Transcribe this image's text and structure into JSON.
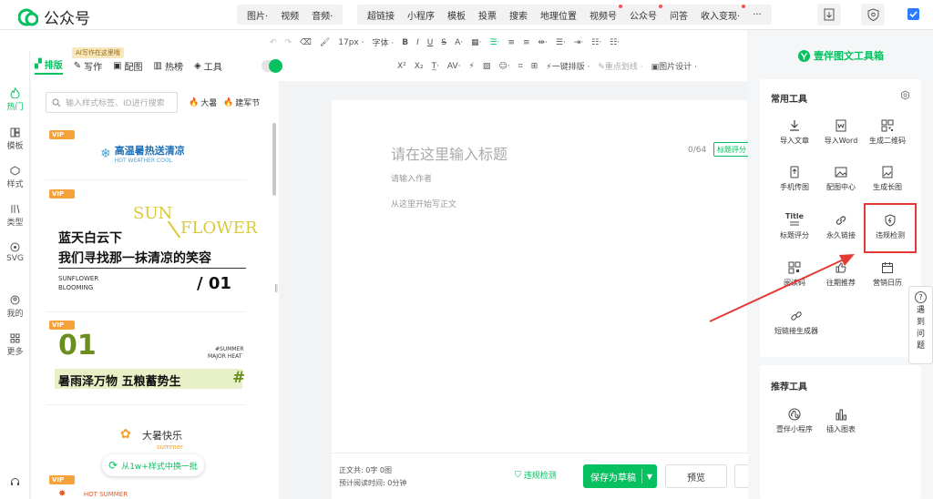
{
  "app": {
    "title": "公众号"
  },
  "topmenu": {
    "group1": [
      "图片·",
      "视频",
      "音频·"
    ],
    "group2": [
      "超链接",
      "小程序",
      "模板",
      "投票",
      "搜索",
      "地理位置",
      "视频号",
      "公众号",
      "问答",
      "收入变现·",
      "···"
    ]
  },
  "tabs": {
    "ai_badge": "AI写作在这里哦",
    "items": [
      "排版",
      "写作",
      "配图",
      "热榜",
      "工具"
    ]
  },
  "leftrail": [
    "热门",
    "模板",
    "样式",
    "类型",
    "SVG",
    "我的",
    "更多"
  ],
  "stylepanel": {
    "search_placeholder": "输入样式标签、ID进行搜索",
    "hot_tags": [
      "大暑",
      "建军节"
    ],
    "vip_label": "VIP",
    "card1": {
      "title": "高温暑热送清凉",
      "sub": "HOT WEATHER COOL"
    },
    "card2": {
      "art1": "SUN",
      "art2": "FLOWER",
      "line1": "蓝天白云下",
      "line2": "我们寻找那一抹清凉的笑容",
      "tag1": "SUNFLOWER",
      "tag2": "BLOOMING",
      "num": "/ 01"
    },
    "card3": {
      "num": "01",
      "tag1": "#SUMMER",
      "tag2": "MAJOR HEAT",
      "line1": "暑雨泽万物 五粮蓄势生",
      "hash": "#"
    },
    "card4": {
      "title": "大暑快乐",
      "sub": "summer"
    },
    "card5": {
      "text": "HOT SUMMER"
    },
    "batch_button": "从1w+样式中换一批"
  },
  "toolbar": {
    "font_size": "17px ·",
    "font_family": "字体 ·",
    "one_click": "一键排版 ·",
    "focus": "重点划线 ·",
    "image_design": "图片设计 ·"
  },
  "editor": {
    "title_placeholder": "请在这里输入标题",
    "title_count": "0/64",
    "title_score": "标题评分",
    "author_placeholder": "请输入作者",
    "body_placeholder": "从这里开始写正文"
  },
  "bottom": {
    "word_count_label": "正文共:",
    "word_count": "0字 0图",
    "read_time_label": "预计阅读时间:",
    "read_time": "0分钟",
    "check": "违规检测",
    "save": "保存为草稿",
    "preview": "预览"
  },
  "rightpanel": {
    "title": "壹伴图文工具箱",
    "common_tools_title": "常用工具",
    "recommended_title": "推荐工具",
    "tools": [
      "导入文章",
      "导入Word",
      "生成二维码",
      "手机传图",
      "配图中心",
      "生成长图",
      "标题评分",
      "永久链接",
      "违规检测",
      "阅读码",
      "往期推荐",
      "营销日历",
      "短链接生成器"
    ],
    "title_icon_text": "Title",
    "recommended": [
      "壹伴小程序",
      "插入图表"
    ]
  },
  "help": {
    "label": [
      "遇",
      "到",
      "问",
      "题"
    ]
  },
  "colors": {
    "brand": "#07c160",
    "highlight": "#e53935",
    "vip": "#f6a23a"
  }
}
